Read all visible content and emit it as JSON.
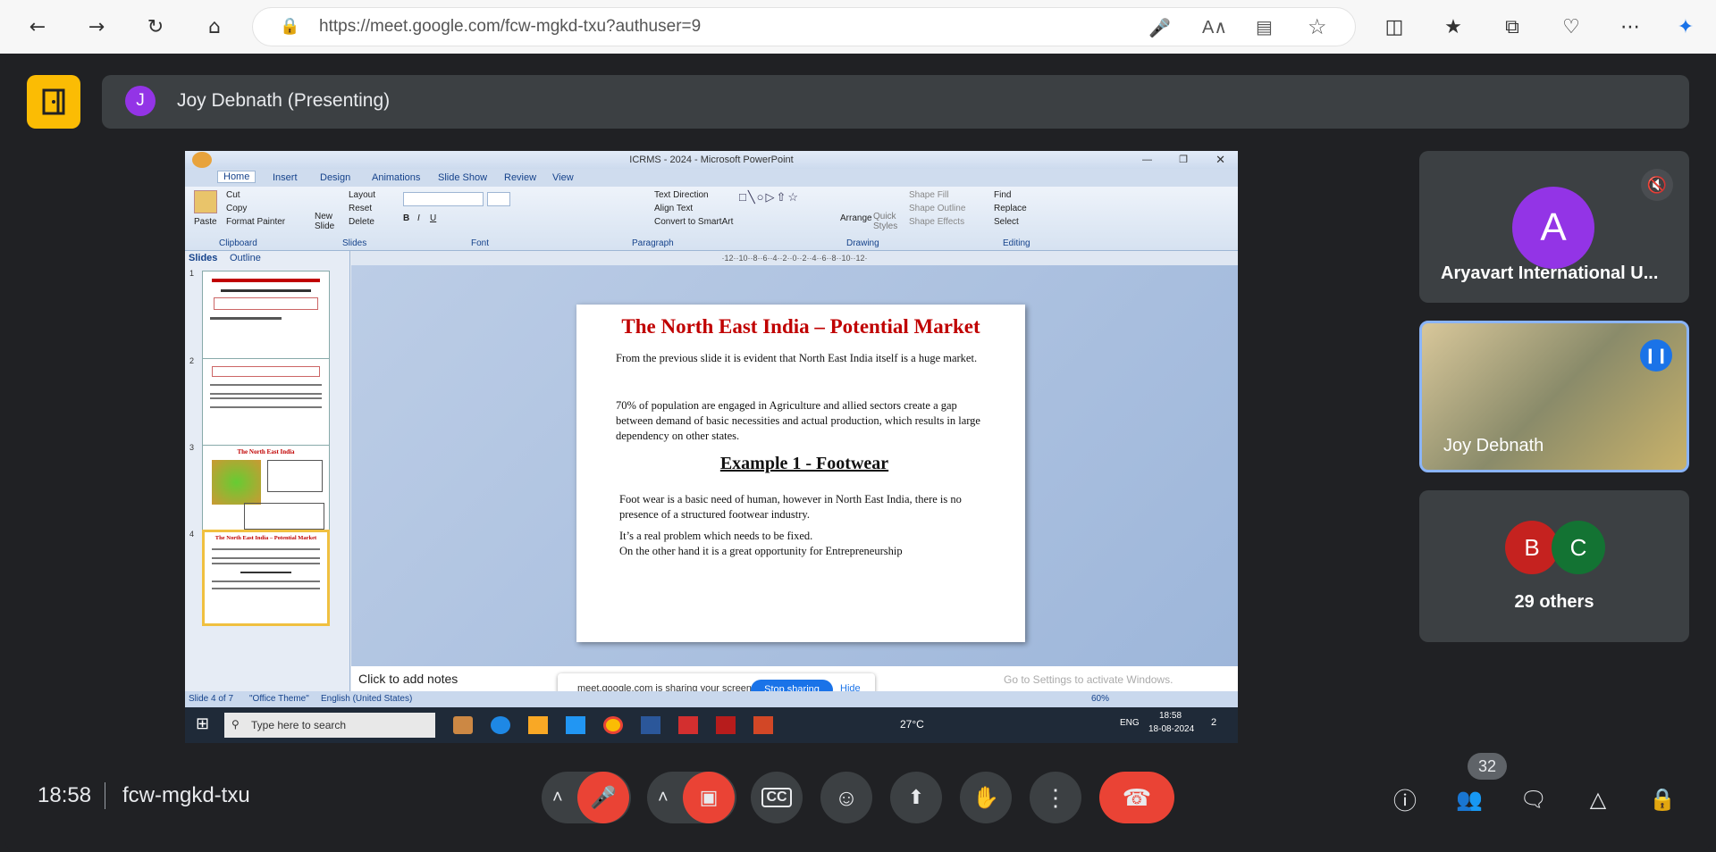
{
  "browser": {
    "url": "https://meet.google.com/fcw-mgkd-txu?authuser=9"
  },
  "meet": {
    "presenter_initial": "J",
    "presenter_label": "Joy Debnath (Presenting)",
    "time": "18:58",
    "meeting_code": "fcw-mgkd-txu",
    "people_count": "32",
    "colors": {
      "accent_red": "#ea4335",
      "logo_yellow": "#fbbc04",
      "tile_bg": "#3c4043"
    }
  },
  "participants": [
    {
      "initial": "A",
      "name": "Aryavart International U...",
      "color": "#9334e6",
      "muted": true
    },
    {
      "name": "Joy Debnath",
      "speaking": true
    },
    {
      "initials": [
        "B",
        "C"
      ],
      "label": "29 others",
      "colors": [
        "#c5221f",
        "#137333"
      ]
    }
  ],
  "ppt": {
    "window_title": "ICRMS - 2024 - Microsoft PowerPoint",
    "tabs": [
      "Home",
      "Insert",
      "Design",
      "Animations",
      "Slide Show",
      "Review",
      "View"
    ],
    "groups": [
      "Clipboard",
      "Slides",
      "Font",
      "Paragraph",
      "Drawing",
      "Editing"
    ],
    "clipboard": {
      "paste": "Paste",
      "cut": "Cut",
      "copy": "Copy",
      "format_painter": "Format Painter"
    },
    "slides_group": {
      "new_slide": "New Slide",
      "layout": "Layout",
      "reset": "Reset",
      "delete": "Delete"
    },
    "paragraph": {
      "text_direction": "Text Direction",
      "align_text": "Align Text",
      "convert": "Convert to SmartArt"
    },
    "drawing": {
      "arrange": "Arrange",
      "quick_styles": "Quick Styles",
      "shape_fill": "Shape Fill",
      "shape_outline": "Shape Outline",
      "shape_effects": "Shape Effects"
    },
    "editing": {
      "find": "Find",
      "replace": "Replace",
      "select": "Select"
    },
    "pane_tabs": [
      "Slides",
      "Outline"
    ],
    "thumb_titles": [
      "",
      "",
      "The North East India",
      "The North East India – Potential Market"
    ],
    "slide": {
      "title": "The North East India – Potential Market",
      "p1": "From the previous slide it is evident that North East India itself is a huge market.",
      "p2": "70% of population are engaged in Agriculture and allied sectors create a gap between demand of basic necessities and actual production, which results in large dependency on other states.",
      "example": "Example 1 - Footwear",
      "p3": "Foot wear is a basic need of human, however in North East India, there is no presence of a structured footwear industry.",
      "p4": "It’s a real problem which needs to be fixed.",
      "p5": "On the other hand it is a great opportunity for Entrepreneurship"
    },
    "notes_placeholder": "Click to add notes",
    "sharing_text": "meet.google.com is sharing your screen.",
    "stop_sharing": "Stop sharing",
    "hide": "Hide",
    "watermark": "Go to Settings to activate Windows.",
    "status": {
      "slide": "Slide 4 of 7",
      "theme": "\"Office Theme\"",
      "lang": "English (United States)",
      "zoom": "60%"
    },
    "taskbar": {
      "search": "Type here to search",
      "temp": "27°C",
      "lang": "ENG",
      "time": "18:58",
      "date": "18-08-2024",
      "notif": "2"
    }
  }
}
